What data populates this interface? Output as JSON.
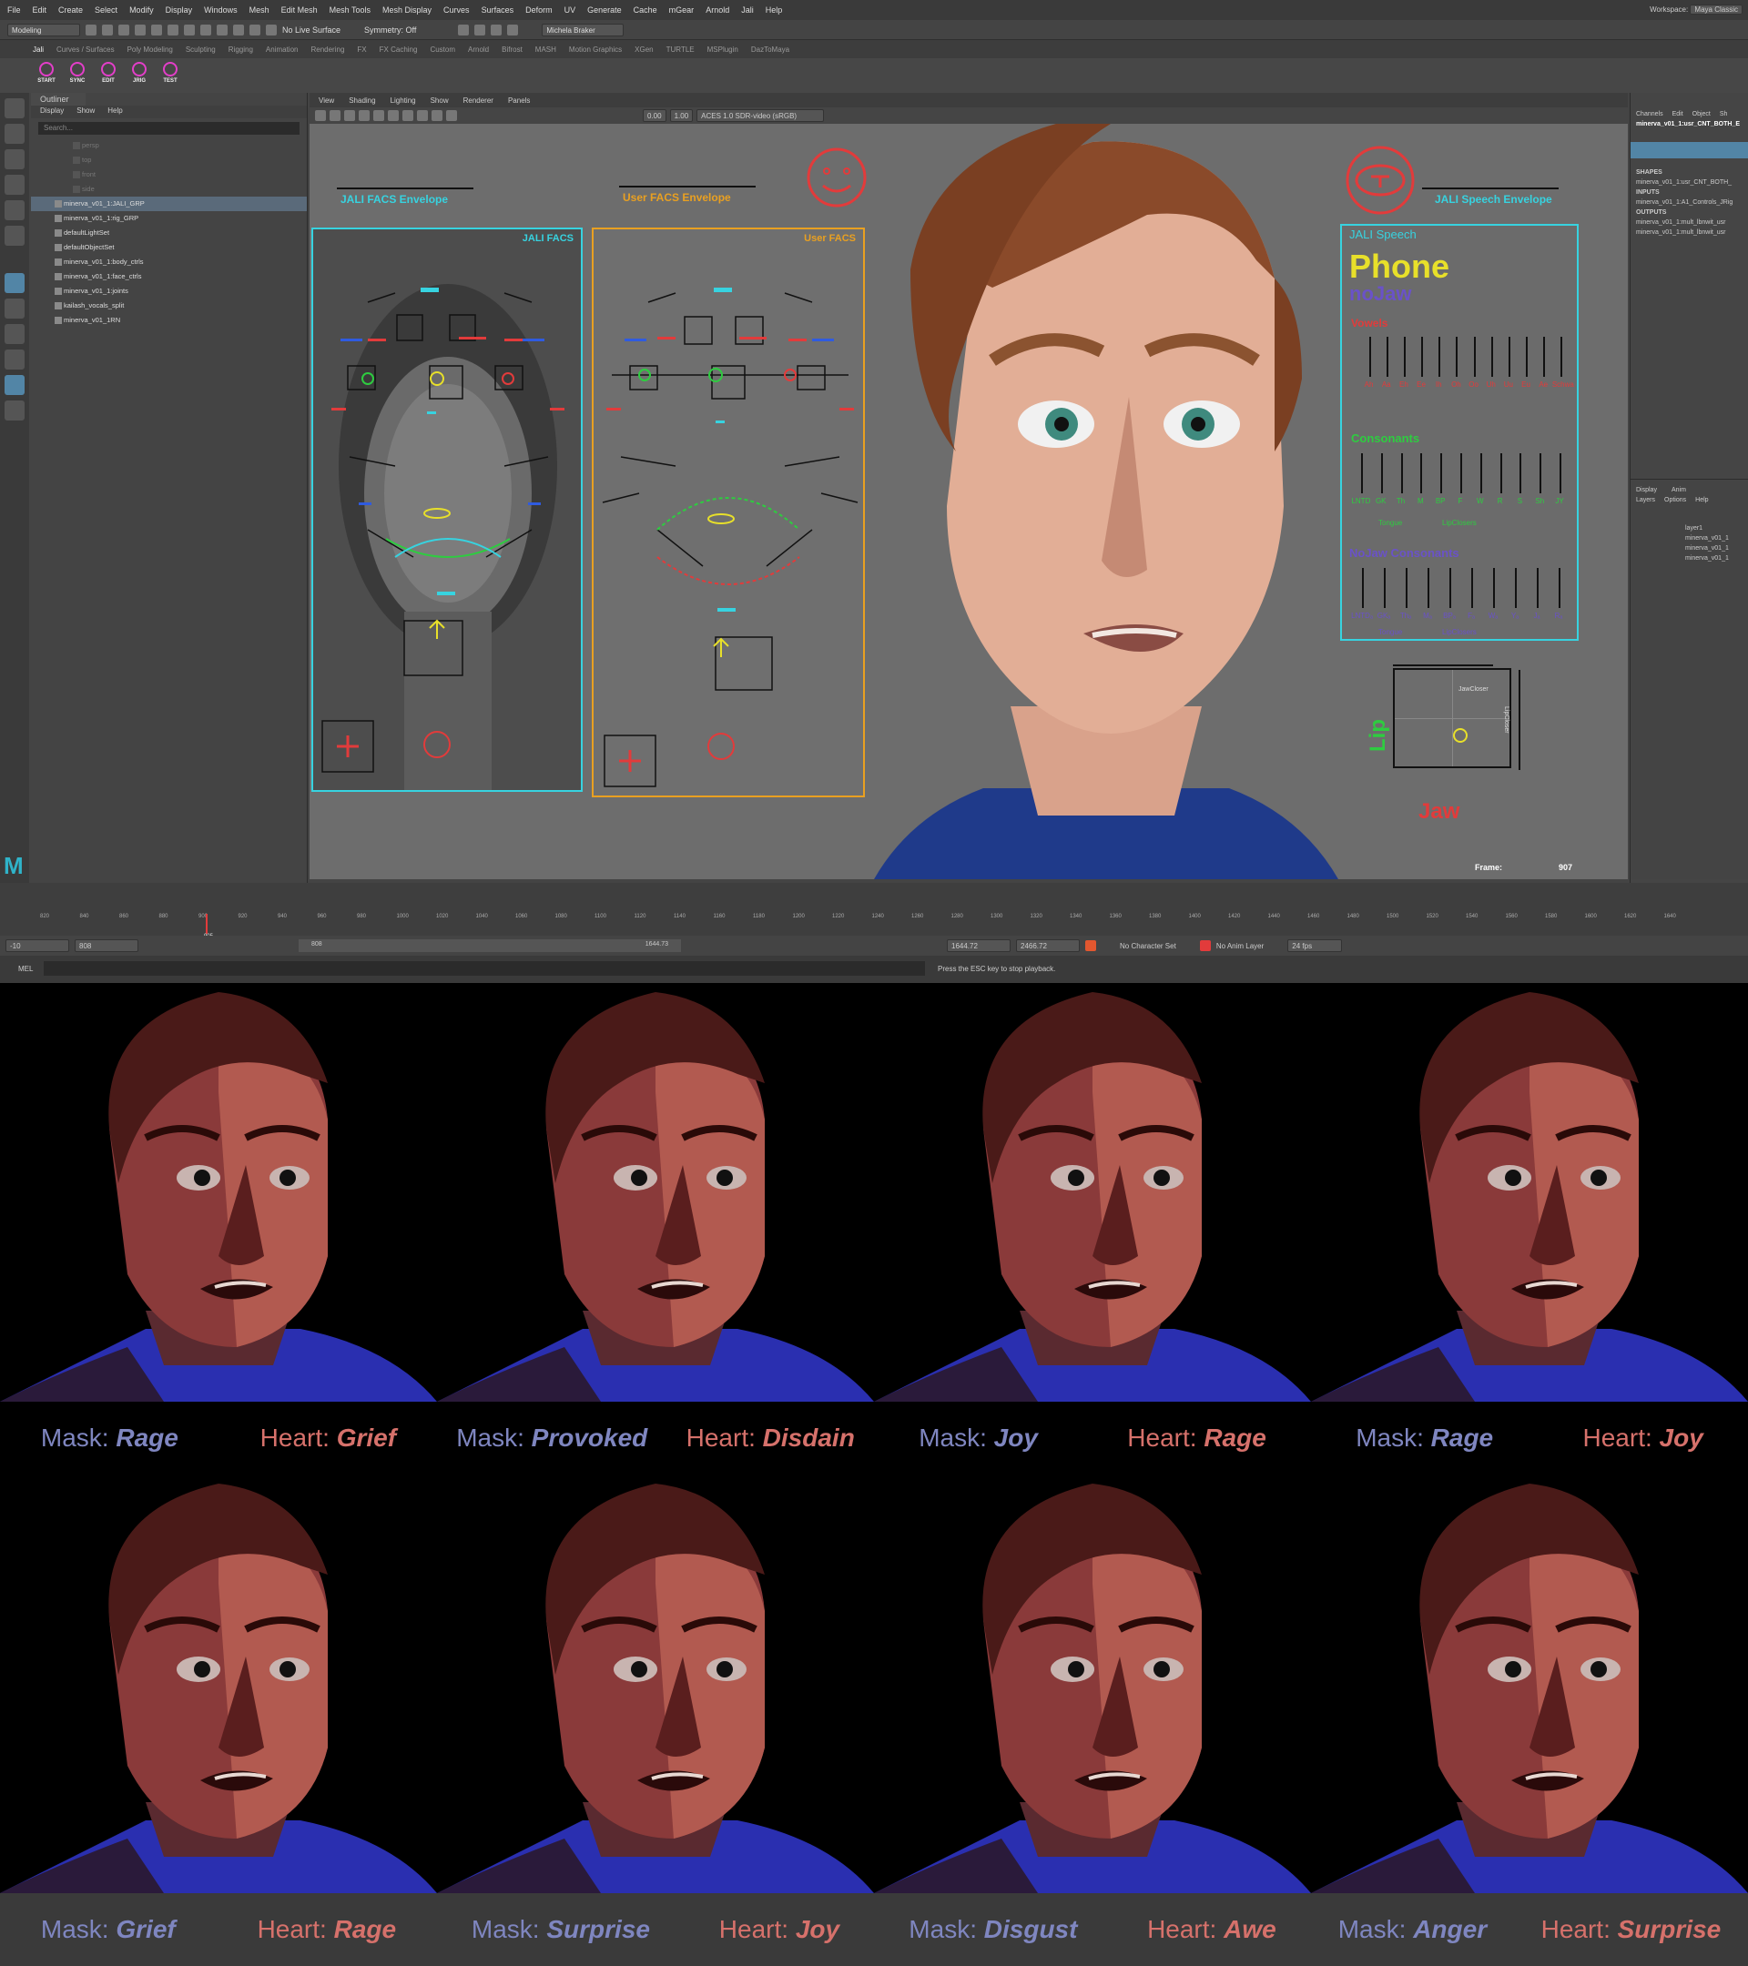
{
  "menubar": [
    "File",
    "Edit",
    "Create",
    "Select",
    "Modify",
    "Display",
    "Windows",
    "Mesh",
    "Edit Mesh",
    "Mesh Tools",
    "Mesh Display",
    "Curves",
    "Surfaces",
    "Deform",
    "UV",
    "Generate",
    "Cache",
    "mGear",
    "Arnold",
    "Jali",
    "Help"
  ],
  "workspace": {
    "label": "Workspace:",
    "value": "Maya Classic"
  },
  "statusline": {
    "mode": "Modeling",
    "live_surface": "No Live Surface",
    "symmetry": "Symmetry: Off",
    "user": "Michela Braker"
  },
  "shelf_tabs": [
    "Jali",
    "Curves / Surfaces",
    "Poly Modeling",
    "Sculpting",
    "Rigging",
    "Animation",
    "Rendering",
    "FX",
    "FX Caching",
    "Custom",
    "Arnold",
    "Bifrost",
    "MASH",
    "Motion Graphics",
    "XGen",
    "TURTLE",
    "MSPlugin",
    "DazToMaya"
  ],
  "shelf_tools": [
    "START",
    "SYNC",
    "EDIT",
    "JRIG",
    "TEST"
  ],
  "outliner": {
    "tab": "Outliner",
    "menu": [
      "Display",
      "Show",
      "Help"
    ],
    "search_placeholder": "Search...",
    "cameras": [
      "persp",
      "top",
      "front",
      "side"
    ],
    "items": [
      "minerva_v01_1:JALI_GRP",
      "minerva_v01_1:rig_GRP",
      "defaultLightSet",
      "defaultObjectSet",
      "minerva_v01_1:body_ctrls",
      "minerva_v01_1:face_ctrls",
      "minerva_v01_1:joints",
      "kailash_vocals_split",
      "minerva_v01_1RN"
    ],
    "selected_index": 0
  },
  "viewport": {
    "menu": [
      "View",
      "Shading",
      "Lighting",
      "Show",
      "Renderer",
      "Panels"
    ],
    "exposure": "0.00",
    "gamma": "1.00",
    "color_space": "ACES 1.0 SDR-video (sRGB)",
    "jali_facs_envelope": "JALI FACS Envelope",
    "user_facs_envelope": "User FACS Envelope",
    "jali_speech_envelope": "JALI Speech Envelope",
    "jali_facs_title": "JALI FACS",
    "user_facs_title": "User FACS",
    "frame_label": "Frame:",
    "frame_value": "907",
    "jaw_label": "Jaw",
    "lip_label": "Lip",
    "jawcloser_label": "JawCloser",
    "lipcloser_label": "LipCloser"
  },
  "speech": {
    "title": "JALI Speech",
    "phone": "Phone",
    "nojaw": "noJaw",
    "vowels": "Vowels",
    "consonants": "Consonants",
    "nojaw_consonants": "NoJaw Consonants",
    "vowel_keys": [
      "Ah",
      "Aa",
      "Eh",
      "Ee",
      "Ih",
      "Oh",
      "Oo",
      "Uh",
      "Uu",
      "Eu",
      "Ae",
      "Schwa"
    ],
    "consonant_keys": [
      "LNTD",
      "GK",
      "Th",
      "M",
      "BP",
      "F",
      "W",
      "R",
      "S",
      "Sh",
      "JY"
    ],
    "nojaw_keys": [
      "LNTDₐ",
      "GKₐ",
      "Thₐ",
      "Mₐ",
      "BPₐ",
      "Fₐ",
      "Wₐ",
      "Yₐ",
      "Jₐ",
      "Rₐ"
    ],
    "tongue": "Tongue",
    "lipclosers": "LipClosers"
  },
  "channel_box": {
    "tabs": [
      "Channels",
      "Edit",
      "Object",
      "Sh"
    ],
    "node": "minerva_v01_1:usr_CNT_BOTH_E",
    "shapes": "SHAPES",
    "shape_node": "minerva_v01_1:usr_CNT_BOTH_",
    "inputs": "INPUTS",
    "input_node": "minerva_v01_1:A1_Controls_JRig",
    "outputs": "OUTPUTS",
    "output_nodes": [
      "minerva_v01_1:mult_lbnwit_usr",
      "minerva_v01_1:mult_lbnwit_usr"
    ],
    "layer_tabs": [
      "Display",
      "Anim"
    ],
    "layer_menu": [
      "Layers",
      "Options",
      "Help"
    ],
    "layers": [
      "layer1",
      "minerva_v01_1",
      "minerva_v01_1",
      "minerva_v01_1"
    ]
  },
  "timeslider": {
    "ticks": [
      "820",
      "840",
      "860",
      "880",
      "900",
      "920",
      "940",
      "960",
      "980",
      "1000",
      "1020",
      "1040",
      "1060",
      "1080",
      "1100",
      "1120",
      "1140",
      "1160",
      "1180",
      "1200",
      "1220",
      "1240",
      "1260",
      "1280",
      "1300",
      "1320",
      "1340",
      "1360",
      "1380",
      "1400",
      "1420",
      "1440",
      "1460",
      "1480",
      "1500",
      "1520",
      "1540",
      "1560",
      "1580",
      "1600",
      "1620",
      "1640"
    ],
    "current": "905"
  },
  "rangebar": {
    "start": "-10",
    "playback_start": "808",
    "range_left": "808",
    "range_right": "1644.73",
    "playback_end": "1644.72",
    "end": "2466.72",
    "character_set": "No Character Set",
    "anim_layer": "No Anim Layer",
    "fps": "24 fps"
  },
  "mel": {
    "label": "MEL",
    "feedback": "Press the ESC key to stop playback."
  },
  "colors": {
    "cyan": "#37d3e0",
    "orange": "#e9a021",
    "mask": "#7f86c0",
    "heart": "#d6716b",
    "phone": "#e8e02a"
  },
  "grid": [
    {
      "mask": "Rage",
      "heart": "Grief"
    },
    {
      "mask": "Provoked",
      "heart": "Disdain"
    },
    {
      "mask": "Joy",
      "heart": "Rage"
    },
    {
      "mask": "Rage",
      "heart": "Joy"
    },
    {
      "mask": "Grief",
      "heart": "Rage"
    },
    {
      "mask": "Surprise",
      "heart": "Joy"
    },
    {
      "mask": "Disgust",
      "heart": "Awe"
    },
    {
      "mask": "Anger",
      "heart": "Surprise"
    }
  ],
  "labels": {
    "mask": "Mask:",
    "heart": "Heart:"
  }
}
